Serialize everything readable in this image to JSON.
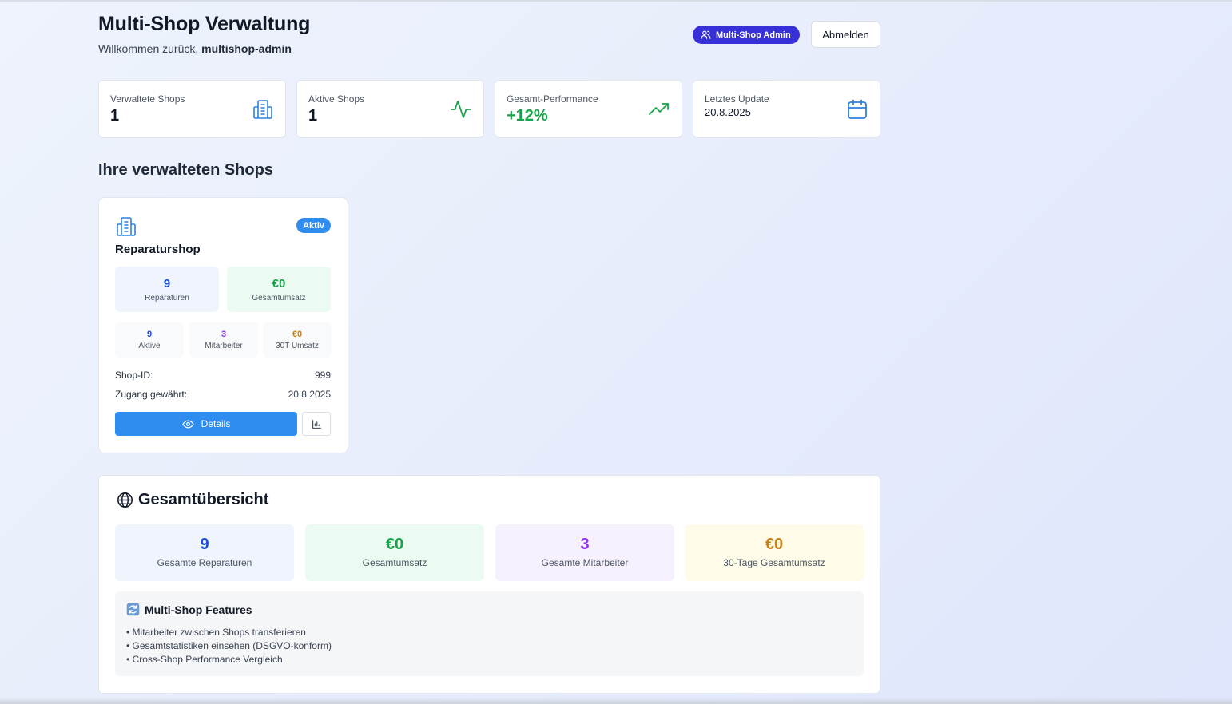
{
  "header": {
    "title": "Multi-Shop Verwaltung",
    "welcome_prefix": "Willkommen zurück,",
    "username": "multishop-admin",
    "role_badge": "Multi-Shop Admin",
    "logout_label": "Abmelden"
  },
  "stats": [
    {
      "label": "Verwaltete Shops",
      "value": "1",
      "icon": "building-icon"
    },
    {
      "label": "Aktive Shops",
      "value": "1",
      "icon": "activity-icon"
    },
    {
      "label": "Gesamt-Performance",
      "value": "+12%",
      "icon": "trending-up-icon"
    },
    {
      "label": "Letztes Update",
      "value": "20.8.2025",
      "icon": "calendar-icon"
    }
  ],
  "section_title": "Ihre verwalteten Shops",
  "shop": {
    "name": "Reparaturshop",
    "status": "Aktiv",
    "big": [
      {
        "value": "9",
        "label": "Reparaturen"
      },
      {
        "value": "€0",
        "label": "Gesamtumsatz"
      }
    ],
    "small": [
      {
        "value": "9",
        "label": "Aktive"
      },
      {
        "value": "3",
        "label": "Mitarbeiter"
      },
      {
        "value": "€0",
        "label": "30T Umsatz"
      }
    ],
    "shop_id_label": "Shop-ID:",
    "shop_id_value": "999",
    "access_label": "Zugang gewährt:",
    "access_value": "20.8.2025",
    "details_label": "Details"
  },
  "overview": {
    "title": "Gesamtübersicht",
    "boxes": [
      {
        "value": "9",
        "label": "Gesamte Reparaturen"
      },
      {
        "value": "€0",
        "label": "Gesamtumsatz"
      },
      {
        "value": "3",
        "label": "Gesamte Mitarbeiter"
      },
      {
        "value": "€0",
        "label": "30-Tage Gesamtumsatz"
      }
    ],
    "features_title": "Multi-Shop Features",
    "features": [
      "• Mitarbeiter zwischen Shops transferieren",
      "• Gesamtstatistiken einsehen (DSGVO-konform)",
      "• Cross-Shop Performance Vergleich"
    ]
  },
  "colors": {
    "blue": "#1d4ed8",
    "green": "#16a34a",
    "purple": "#9333ea",
    "amber": "#c2841a",
    "accent": "#2f8df0",
    "badge": "#3730d9"
  }
}
